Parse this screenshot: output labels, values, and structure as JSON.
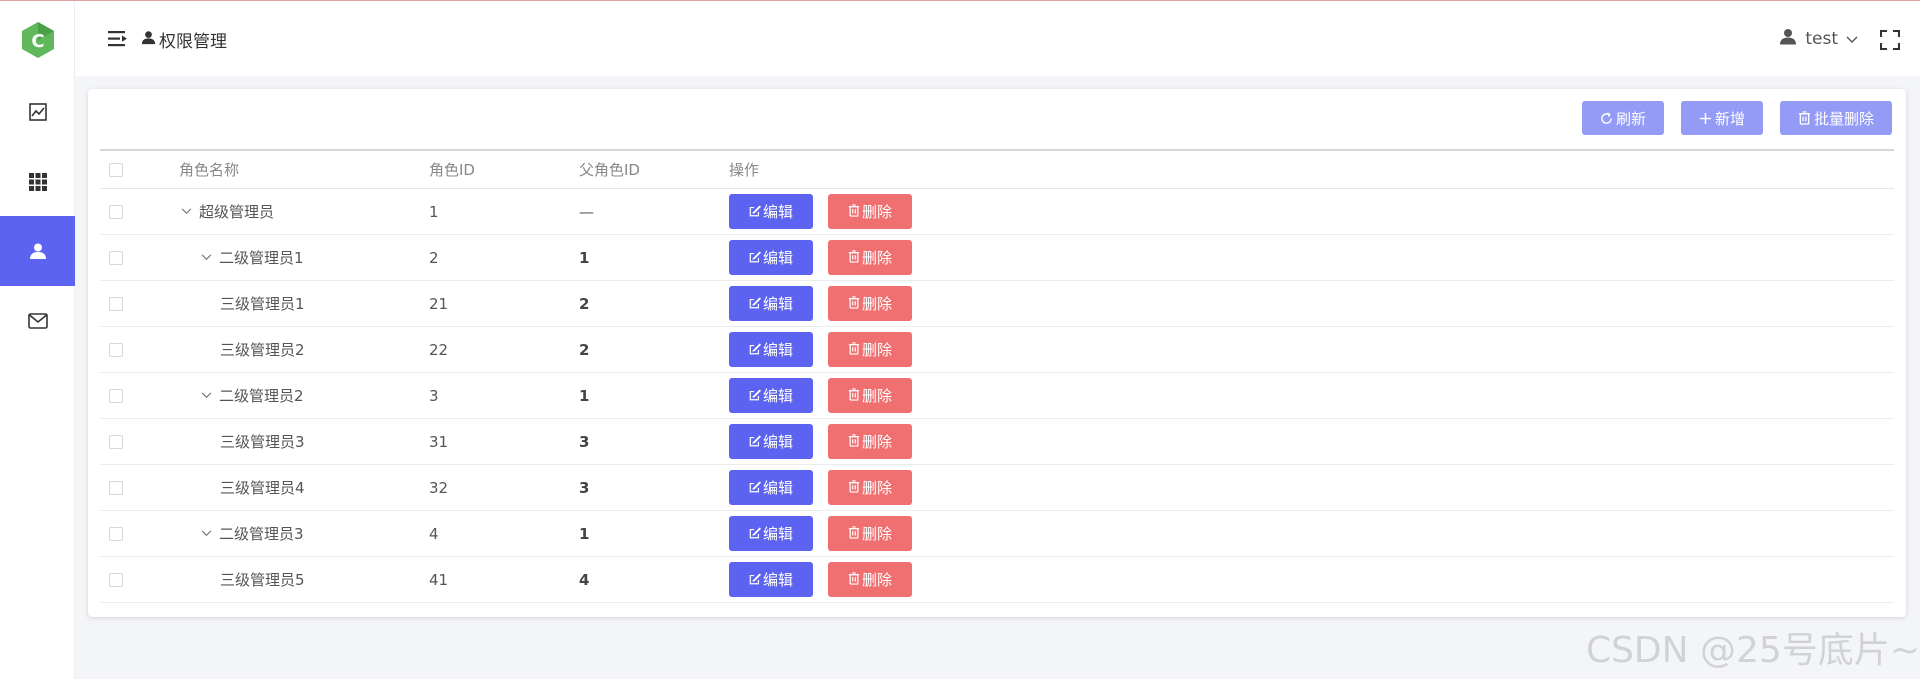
{
  "header": {
    "breadcrumb": "权限管理",
    "user_name": "test"
  },
  "sidebar": {
    "items": [
      {
        "icon": "chart-line-icon",
        "active": false
      },
      {
        "icon": "grid-icon",
        "active": false
      },
      {
        "icon": "user-icon",
        "active": true
      },
      {
        "icon": "mail-icon",
        "active": false
      }
    ]
  },
  "toolbar": {
    "refresh_label": "刷新",
    "add_label": "新增",
    "batch_delete_label": "批量删除"
  },
  "table": {
    "columns": [
      "角色名称",
      "角色ID",
      "父角色ID",
      "操作"
    ],
    "edit_label": "编辑",
    "delete_label": "删除",
    "rows": [
      {
        "name": "超级管理员",
        "id": "1",
        "pid": "—",
        "level": 0,
        "expandable": true
      },
      {
        "name": "二级管理员1",
        "id": "2",
        "pid": "1",
        "level": 1,
        "expandable": true
      },
      {
        "name": "三级管理员1",
        "id": "21",
        "pid": "2",
        "level": 2,
        "expandable": false
      },
      {
        "name": "三级管理员2",
        "id": "22",
        "pid": "2",
        "level": 2,
        "expandable": false
      },
      {
        "name": "二级管理员2",
        "id": "3",
        "pid": "1",
        "level": 1,
        "expandable": true
      },
      {
        "name": "三级管理员3",
        "id": "31",
        "pid": "3",
        "level": 2,
        "expandable": false
      },
      {
        "name": "三级管理员4",
        "id": "32",
        "pid": "3",
        "level": 2,
        "expandable": false
      },
      {
        "name": "二级管理员3",
        "id": "4",
        "pid": "1",
        "level": 1,
        "expandable": true
      },
      {
        "name": "三级管理员5",
        "id": "41",
        "pid": "4",
        "level": 2,
        "expandable": false
      }
    ]
  },
  "colors": {
    "primary": "#5b63f0",
    "danger": "#f07071",
    "toolbar_button": "#949bf7"
  },
  "watermark": "CSDN @25号底片~"
}
